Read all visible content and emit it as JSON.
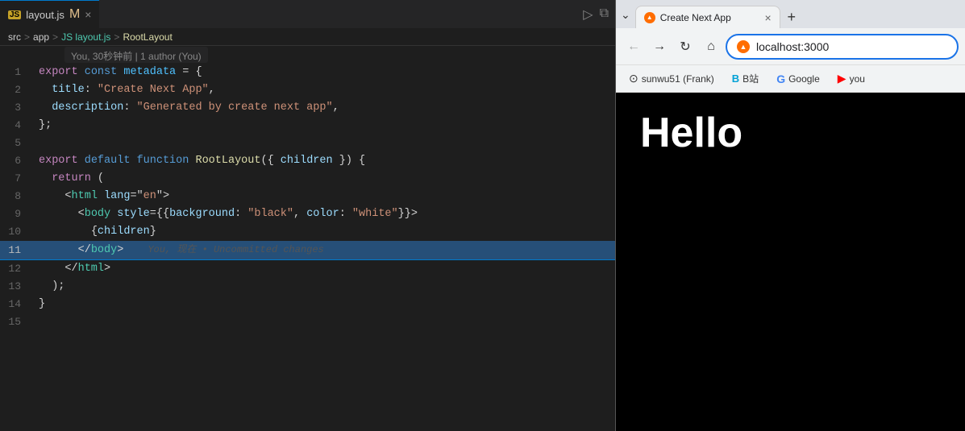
{
  "vscode": {
    "tab": {
      "filename": "layout.js",
      "modified": true
    },
    "breadcrumb": {
      "src": "src",
      "sep1": ">",
      "app": "app",
      "sep2": ">",
      "js_label": "JS layout.js",
      "sep3": ">",
      "func_label": "RootLayout"
    },
    "blame": {
      "text": "You, 30秒钟前 | 1 author (You)"
    },
    "lines": [
      {
        "num": "1",
        "content": "export const metadata = {",
        "gutter": "yellow"
      },
      {
        "num": "2",
        "content": "  title: \"Create Next App\",",
        "gutter": "yellow"
      },
      {
        "num": "3",
        "content": "  description: \"Generated by create next app\",",
        "gutter": ""
      },
      {
        "num": "4",
        "content": "};",
        "gutter": ""
      },
      {
        "num": "5",
        "content": "",
        "gutter": ""
      },
      {
        "num": "6",
        "content": "export default function RootLayout({ children }) {",
        "gutter": ""
      },
      {
        "num": "7",
        "content": "  return (",
        "gutter": ""
      },
      {
        "num": "8",
        "content": "    <html lang=\"en\">",
        "gutter": ""
      },
      {
        "num": "9",
        "content": "      <body style={{background: \"black\", color: \"white\"}}>",
        "gutter": ""
      },
      {
        "num": "10",
        "content": "        {children}",
        "gutter": ""
      },
      {
        "num": "11",
        "content": "      </body>",
        "gutter": "blue",
        "highlighted": true,
        "ghost": "You, 现在 • Uncommitted changes"
      },
      {
        "num": "12",
        "content": "    </html>",
        "gutter": ""
      },
      {
        "num": "13",
        "content": "  );",
        "gutter": ""
      },
      {
        "num": "14",
        "content": "}",
        "gutter": ""
      },
      {
        "num": "15",
        "content": "",
        "gutter": ""
      }
    ]
  },
  "browser": {
    "tab_title": "Create Next App",
    "tab_favicon": "▲",
    "address": "localhost:3000",
    "nav": {
      "back_label": "←",
      "forward_label": "→",
      "reload_label": "↻",
      "home_label": "⌂"
    },
    "bookmarks": [
      {
        "icon_type": "gh",
        "label": "sunwu51 (Frank)"
      },
      {
        "icon_type": "bili",
        "label": "B站"
      },
      {
        "icon_type": "g",
        "label": "Google"
      },
      {
        "icon_type": "yt",
        "label": "you"
      }
    ],
    "content_text": "Hello"
  }
}
